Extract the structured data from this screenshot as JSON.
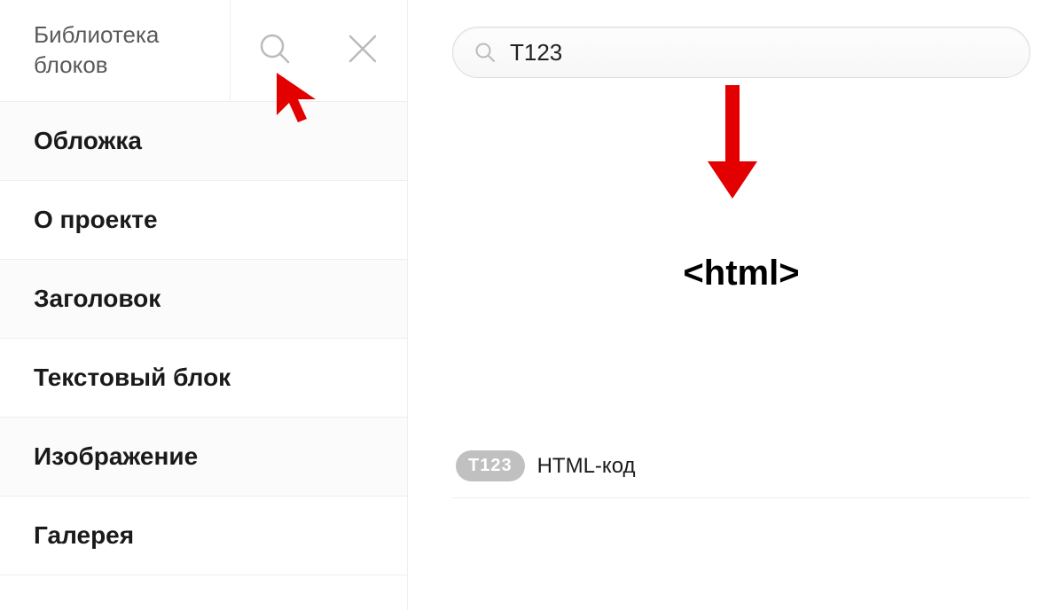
{
  "sidebar": {
    "title": "Библиотека блоков",
    "items": [
      {
        "label": "Обложка"
      },
      {
        "label": "О проекте"
      },
      {
        "label": "Заголовок"
      },
      {
        "label": "Текстовый блок"
      },
      {
        "label": "Изображение"
      },
      {
        "label": "Галерея"
      }
    ]
  },
  "search": {
    "value": "T123"
  },
  "result": {
    "preview_text": "<html>",
    "badge": "T123",
    "label": "HTML-код"
  }
}
